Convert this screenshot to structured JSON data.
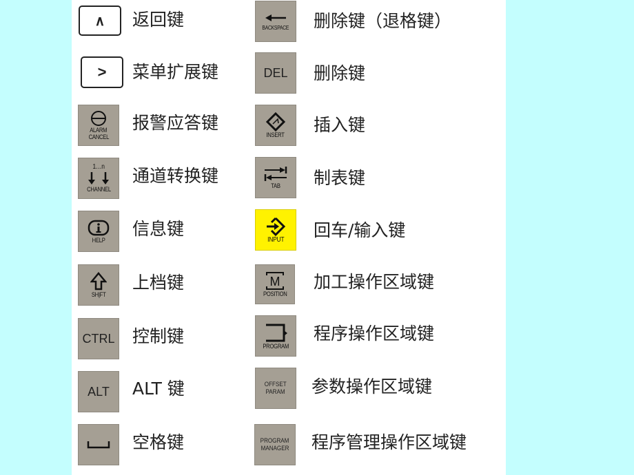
{
  "left_column": [
    {
      "key_label": "∧",
      "description": "返回键",
      "icon": "caret-up-icon"
    },
    {
      "key_label": ">",
      "description": "菜单扩展键",
      "icon": "chevron-right-icon"
    },
    {
      "key_label": "ALARM\nCANCEL",
      "key_line1": "ALARM",
      "key_line2": "CANCEL",
      "description": "报警应答键",
      "icon": "alarm-cancel-icon"
    },
    {
      "key_top": "1…n",
      "key_label": "CHANNEL",
      "description": "通道转换键",
      "icon": "channel-arrows-icon"
    },
    {
      "key_label": "HELP",
      "description": "信息键",
      "icon": "info-icon"
    },
    {
      "key_label": "SH|FT",
      "description": "上档键",
      "icon": "shift-arrow-icon"
    },
    {
      "key_label": "CTRL",
      "description": "控制键",
      "icon": "ctrl-text"
    },
    {
      "key_label": "ALT",
      "description": "ALT 键",
      "icon": "alt-text"
    },
    {
      "key_label": "␣",
      "description": "空格键",
      "icon": "space-bracket-icon"
    }
  ],
  "right_column": [
    {
      "key_label": "BACKSPACE",
      "description": "删除键（退格键）",
      "icon": "left-arrow-icon"
    },
    {
      "key_label": "DEL",
      "description": "删除键",
      "icon": "del-text"
    },
    {
      "key_label": "INSERT",
      "description": "插入键",
      "icon": "insert-diamond-icon"
    },
    {
      "key_label": "TAB",
      "description": "制表键",
      "icon": "tab-arrows-icon"
    },
    {
      "key_label": "INPUT",
      "description": "回车/输入键",
      "icon": "input-diamond-arrow-icon",
      "color": "#fff200"
    },
    {
      "key_label": "POSITION",
      "description": "加工操作区域键",
      "icon": "machine-m-icon"
    },
    {
      "key_label": "PROGRAM",
      "description": "程序操作区域键",
      "icon": "program-bracket-icon"
    },
    {
      "key_line1": "OFFSET",
      "key_line2": "PARAM",
      "description": "参数操作区域键",
      "icon": "offset-param-text"
    },
    {
      "key_line1": "PROGRAM",
      "key_line2": "MANAGER",
      "description": "程序管理操作区域键",
      "icon": "program-manager-text"
    }
  ],
  "colors": {
    "background": "#c4fefe",
    "panel": "#ffffff",
    "key_gray": "#a59f94",
    "key_yellow": "#fff200"
  }
}
